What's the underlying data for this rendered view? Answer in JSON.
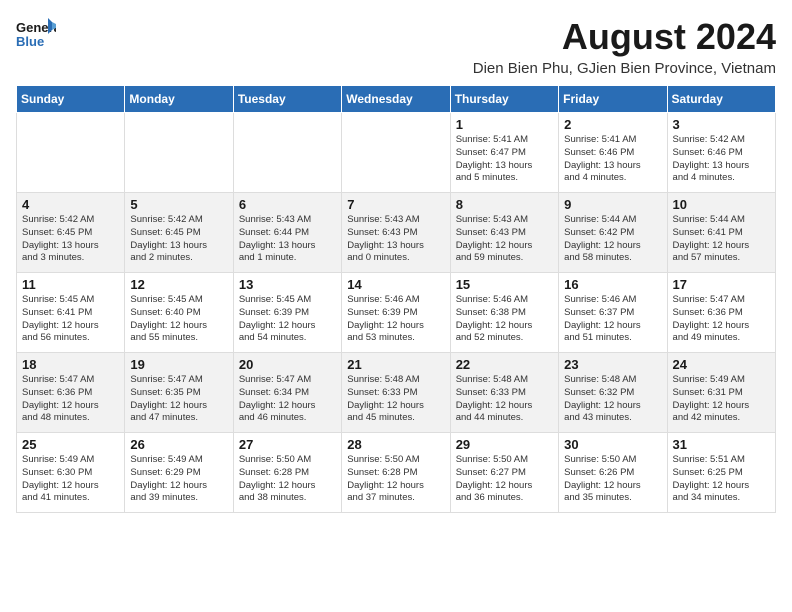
{
  "logo": {
    "line1": "General",
    "line2": "Blue"
  },
  "header": {
    "title": "August 2024",
    "location": "Dien Bien Phu, GJien Bien Province, Vietnam"
  },
  "weekdays": [
    "Sunday",
    "Monday",
    "Tuesday",
    "Wednesday",
    "Thursday",
    "Friday",
    "Saturday"
  ],
  "weeks": [
    [
      {
        "day": "",
        "info": ""
      },
      {
        "day": "",
        "info": ""
      },
      {
        "day": "",
        "info": ""
      },
      {
        "day": "",
        "info": ""
      },
      {
        "day": "1",
        "info": "Sunrise: 5:41 AM\nSunset: 6:47 PM\nDaylight: 13 hours\nand 5 minutes."
      },
      {
        "day": "2",
        "info": "Sunrise: 5:41 AM\nSunset: 6:46 PM\nDaylight: 13 hours\nand 4 minutes."
      },
      {
        "day": "3",
        "info": "Sunrise: 5:42 AM\nSunset: 6:46 PM\nDaylight: 13 hours\nand 4 minutes."
      }
    ],
    [
      {
        "day": "4",
        "info": "Sunrise: 5:42 AM\nSunset: 6:45 PM\nDaylight: 13 hours\nand 3 minutes."
      },
      {
        "day": "5",
        "info": "Sunrise: 5:42 AM\nSunset: 6:45 PM\nDaylight: 13 hours\nand 2 minutes."
      },
      {
        "day": "6",
        "info": "Sunrise: 5:43 AM\nSunset: 6:44 PM\nDaylight: 13 hours\nand 1 minute."
      },
      {
        "day": "7",
        "info": "Sunrise: 5:43 AM\nSunset: 6:43 PM\nDaylight: 13 hours\nand 0 minutes."
      },
      {
        "day": "8",
        "info": "Sunrise: 5:43 AM\nSunset: 6:43 PM\nDaylight: 12 hours\nand 59 minutes."
      },
      {
        "day": "9",
        "info": "Sunrise: 5:44 AM\nSunset: 6:42 PM\nDaylight: 12 hours\nand 58 minutes."
      },
      {
        "day": "10",
        "info": "Sunrise: 5:44 AM\nSunset: 6:41 PM\nDaylight: 12 hours\nand 57 minutes."
      }
    ],
    [
      {
        "day": "11",
        "info": "Sunrise: 5:45 AM\nSunset: 6:41 PM\nDaylight: 12 hours\nand 56 minutes."
      },
      {
        "day": "12",
        "info": "Sunrise: 5:45 AM\nSunset: 6:40 PM\nDaylight: 12 hours\nand 55 minutes."
      },
      {
        "day": "13",
        "info": "Sunrise: 5:45 AM\nSunset: 6:39 PM\nDaylight: 12 hours\nand 54 minutes."
      },
      {
        "day": "14",
        "info": "Sunrise: 5:46 AM\nSunset: 6:39 PM\nDaylight: 12 hours\nand 53 minutes."
      },
      {
        "day": "15",
        "info": "Sunrise: 5:46 AM\nSunset: 6:38 PM\nDaylight: 12 hours\nand 52 minutes."
      },
      {
        "day": "16",
        "info": "Sunrise: 5:46 AM\nSunset: 6:37 PM\nDaylight: 12 hours\nand 51 minutes."
      },
      {
        "day": "17",
        "info": "Sunrise: 5:47 AM\nSunset: 6:36 PM\nDaylight: 12 hours\nand 49 minutes."
      }
    ],
    [
      {
        "day": "18",
        "info": "Sunrise: 5:47 AM\nSunset: 6:36 PM\nDaylight: 12 hours\nand 48 minutes."
      },
      {
        "day": "19",
        "info": "Sunrise: 5:47 AM\nSunset: 6:35 PM\nDaylight: 12 hours\nand 47 minutes."
      },
      {
        "day": "20",
        "info": "Sunrise: 5:47 AM\nSunset: 6:34 PM\nDaylight: 12 hours\nand 46 minutes."
      },
      {
        "day": "21",
        "info": "Sunrise: 5:48 AM\nSunset: 6:33 PM\nDaylight: 12 hours\nand 45 minutes."
      },
      {
        "day": "22",
        "info": "Sunrise: 5:48 AM\nSunset: 6:33 PM\nDaylight: 12 hours\nand 44 minutes."
      },
      {
        "day": "23",
        "info": "Sunrise: 5:48 AM\nSunset: 6:32 PM\nDaylight: 12 hours\nand 43 minutes."
      },
      {
        "day": "24",
        "info": "Sunrise: 5:49 AM\nSunset: 6:31 PM\nDaylight: 12 hours\nand 42 minutes."
      }
    ],
    [
      {
        "day": "25",
        "info": "Sunrise: 5:49 AM\nSunset: 6:30 PM\nDaylight: 12 hours\nand 41 minutes."
      },
      {
        "day": "26",
        "info": "Sunrise: 5:49 AM\nSunset: 6:29 PM\nDaylight: 12 hours\nand 39 minutes."
      },
      {
        "day": "27",
        "info": "Sunrise: 5:50 AM\nSunset: 6:28 PM\nDaylight: 12 hours\nand 38 minutes."
      },
      {
        "day": "28",
        "info": "Sunrise: 5:50 AM\nSunset: 6:28 PM\nDaylight: 12 hours\nand 37 minutes."
      },
      {
        "day": "29",
        "info": "Sunrise: 5:50 AM\nSunset: 6:27 PM\nDaylight: 12 hours\nand 36 minutes."
      },
      {
        "day": "30",
        "info": "Sunrise: 5:50 AM\nSunset: 6:26 PM\nDaylight: 12 hours\nand 35 minutes."
      },
      {
        "day": "31",
        "info": "Sunrise: 5:51 AM\nSunset: 6:25 PM\nDaylight: 12 hours\nand 34 minutes."
      }
    ]
  ]
}
